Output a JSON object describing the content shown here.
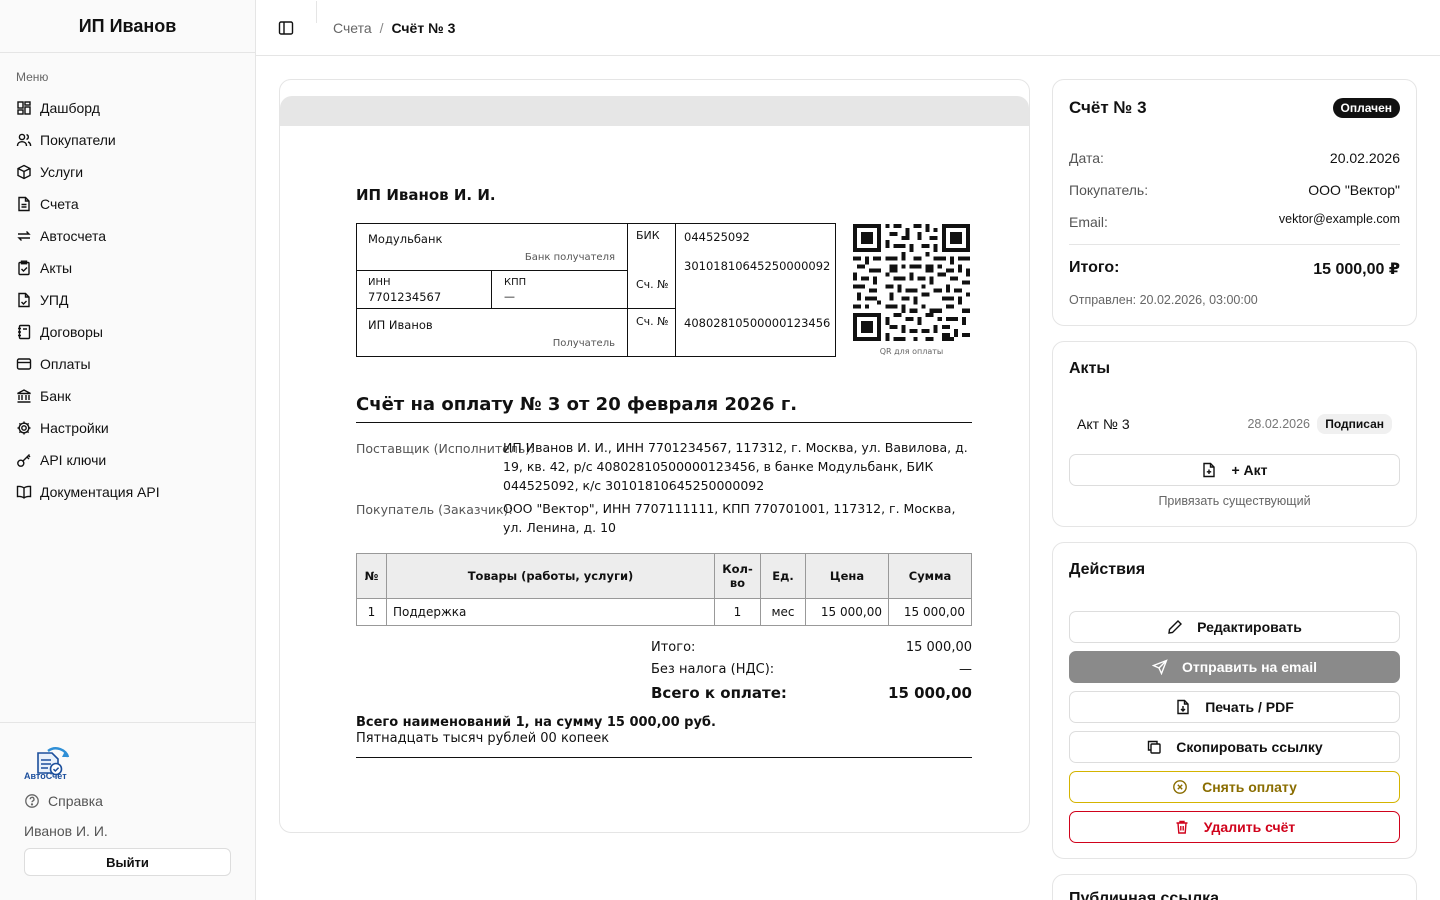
{
  "sidebar": {
    "brand": "ИП Иванов",
    "menu_caption": "Меню",
    "items": [
      {
        "label": "Дашборд",
        "icon": "dashboard-icon"
      },
      {
        "label": "Покупатели",
        "icon": "users-icon"
      },
      {
        "label": "Услуги",
        "icon": "box-icon"
      },
      {
        "label": "Счета",
        "icon": "file-icon"
      },
      {
        "label": "Автосчета",
        "icon": "repeat-icon"
      },
      {
        "label": "Акты",
        "icon": "clipboard-check-icon"
      },
      {
        "label": "УПД",
        "icon": "file-check-icon"
      },
      {
        "label": "Договоры",
        "icon": "notebook-icon"
      },
      {
        "label": "Оплаты",
        "icon": "credit-card-icon"
      },
      {
        "label": "Банк",
        "icon": "bank-icon"
      },
      {
        "label": "Настройки",
        "icon": "gear-icon"
      },
      {
        "label": "API ключи",
        "icon": "key-icon"
      },
      {
        "label": "Документация API",
        "icon": "book-icon"
      }
    ],
    "logo_text": "АвтоСчет",
    "help": "Справка",
    "user": "Иванов И. И.",
    "logout": "Выйти"
  },
  "topbar": {
    "crumb_parent": "Счета",
    "crumb_sep": "/",
    "crumb_current": "Счёт № 3"
  },
  "invoice": {
    "seller_title": "ИП Иванов И. И.",
    "bank": {
      "bank_name": "Модульбанк",
      "bank_caption": "Банк получателя",
      "bik_label": "БИК",
      "bik": "044525092",
      "corr_account": "30101810645250000092",
      "inn_label": "ИНН",
      "inn": "7701234567",
      "kpp_label": "КПП",
      "kpp": "—",
      "account_label": "Сч. №",
      "account_label_2": "Сч. №",
      "account": "40802810500000123456",
      "recipient": "ИП Иванов",
      "recipient_caption": "Получатель"
    },
    "qr_caption": "QR для оплаты",
    "title": "Счёт на оплату № 3 от 20 февраля 2026 г.",
    "supplier_label": "Поставщик (Исполнитель):",
    "supplier_value": "ИП Иванов И. И., ИНН 7701234567, 117312, г. Москва, ул. Вавилова, д. 19, кв. 42, р/с 40802810500000123456, в банке Модульбанк, БИК 044525092, к/с 30101810645250000092",
    "buyer_label": "Покупатель (Заказчик):",
    "buyer_value": "ООО \"Вектор\", ИНН 7707111111, КПП 770701001, 117312, г. Москва, ул. Ленина, д. 10",
    "table": {
      "headers": {
        "num": "№",
        "name": "Товары (работы, услуги)",
        "qty": "Кол-во",
        "unit": "Ед.",
        "price": "Цена",
        "sum": "Сумма"
      },
      "rows": [
        {
          "num": "1",
          "name": "Поддержка",
          "qty": "1",
          "unit": "мес",
          "price": "15 000,00",
          "sum": "15 000,00"
        }
      ]
    },
    "totals": {
      "total_label": "Итого:",
      "total_value": "15 000,00",
      "vat_label": "Без налога (НДС):",
      "vat_value": "—",
      "grand_label": "Всего к оплате:",
      "grand_value": "15 000,00"
    },
    "sum_words_1": "Всего наименований 1, на сумму 15 000,00 руб.",
    "sum_words_2": "Пятнадцать тысяч рублей 00 копеек"
  },
  "summary": {
    "title": "Счёт № 3",
    "status": "Оплачен",
    "date_label": "Дата:",
    "date": "20.02.2026",
    "buyer_label": "Покупатель:",
    "buyer": "ООО \"Вектор\"",
    "email_label": "Email:",
    "email": "vektor@example.com",
    "total_label": "Итого:",
    "total": "15 000,00 ₽",
    "sent": "Отправлен: 20.02.2026, 03:00:00"
  },
  "acts": {
    "title": "Акты",
    "act_name": "Акт № 3",
    "act_date": "28.02.2026",
    "act_status": "Подписан",
    "add_button": "+ Акт",
    "link_existing": "Привязать существующий"
  },
  "actions": {
    "title": "Действия",
    "edit": "Редактировать",
    "send_email": "Отправить на email",
    "print": "Печать / PDF",
    "copy_link": "Скопировать ссылку",
    "remove_payment": "Снять оплату",
    "delete": "Удалить счёт"
  },
  "public_link": {
    "title": "Публичная ссылка"
  },
  "colors": {
    "accent_dark": "#111111",
    "warning": "#c9a400",
    "danger": "#d0021b",
    "disabled_button": "#8a8a8a"
  }
}
